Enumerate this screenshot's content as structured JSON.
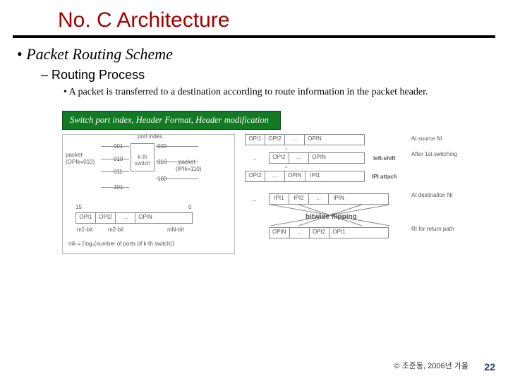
{
  "title": "No. C Architecture",
  "bullets": {
    "l1": "Packet Routing Scheme",
    "l2": "Routing Process",
    "l3": "A packet is transferred to a destination according to route information in the packet header."
  },
  "greenbox": "Switch port index, Header Format, Header modification",
  "left_diagram": {
    "top_label": "port index",
    "packet_label": "packet",
    "opix0": "(OPIk=010)",
    "ports_left": [
      "001",
      "010",
      "011",
      "101"
    ],
    "ports_right": [
      "000",
      "010",
      "100"
    ],
    "switch_label": "k-th switch",
    "packet_right": "packet",
    "opix1": "(IPIk=110)",
    "axis15": "15",
    "axis0": "0",
    "header_cells": [
      "OPI1",
      "OPI2",
      "...",
      "OPIN"
    ],
    "bit_labels": [
      "m1-bit",
      "m2-bit",
      "mN-bit"
    ],
    "formula": "mk = ⌈log₂(number of ports of k-th switch)⌉"
  },
  "right_diagram": {
    "row1": [
      "OPI1",
      "OPI2",
      "...",
      "OPIN"
    ],
    "row1_right": "At source NI",
    "row2_left": "...",
    "row2": [
      "OPI2",
      "...",
      "OPIN"
    ],
    "row2_right": "After 1st switching",
    "leftshift": "left-shift",
    "row3": [
      "OPI2",
      "...",
      "OPIN",
      "IPI1"
    ],
    "ipi_attach": "IPI attach",
    "row4_left": "...",
    "row4": [
      "IPI1",
      "IPI2",
      "...",
      "IPIN"
    ],
    "row4_right": "At destination NI",
    "flip": "bitwise flipping",
    "row5": [
      "OPIN",
      "...",
      "OPI2",
      "OPI1"
    ],
    "row5_right": "RI for return path"
  },
  "footer": "© 조준동, 2006년 가을",
  "page": "22"
}
